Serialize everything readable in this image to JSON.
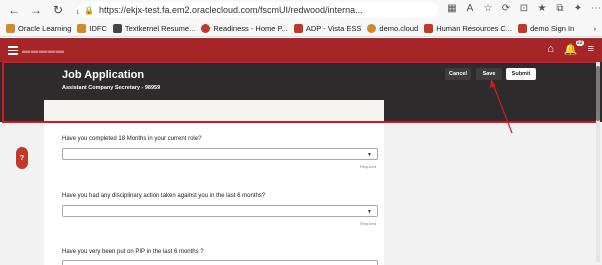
{
  "browser": {
    "url": "https://ekjx-test.fa.em2.oraclecloud.com/fscmUI/redwood/interna...",
    "bookmarks": [
      {
        "label": "Oracle Learning",
        "color": "#d08a2a"
      },
      {
        "label": "IDFC",
        "color": "#d08a2a"
      },
      {
        "label": "Textkernel Resume...",
        "color": "#444444"
      },
      {
        "label": "Readiness - Home P...",
        "color": "#c0392b"
      },
      {
        "label": "ADP - Vista ESS",
        "color": "#c0392b"
      },
      {
        "label": "demo.cloud",
        "color": "#d08a2a"
      },
      {
        "label": "Human Resources C...",
        "color": "#c0392b"
      },
      {
        "label": "demo Sign In",
        "color": "#c0392b"
      }
    ]
  },
  "app": {
    "notification_count": "22"
  },
  "header": {
    "title": "Job Application",
    "subtitle": "Assistant Company Secretary - 98959",
    "cancel_label": "Cancel",
    "save_label": "Save",
    "submit_label": "Submit"
  },
  "questions": [
    {
      "label": "Have you completed 18 Months in your current role?",
      "value": "",
      "required_text": "Required"
    },
    {
      "label": "Have you had any disciplinary action taken against you in the last 6 months?",
      "value": "",
      "required_text": "Required"
    },
    {
      "label": "Have you very been put on PIP in the last 6 months ?",
      "value": ""
    }
  ],
  "colors": {
    "brand_red": "#a52529",
    "hero_dark": "#2d2b2b",
    "highlight": "#d11a22"
  }
}
